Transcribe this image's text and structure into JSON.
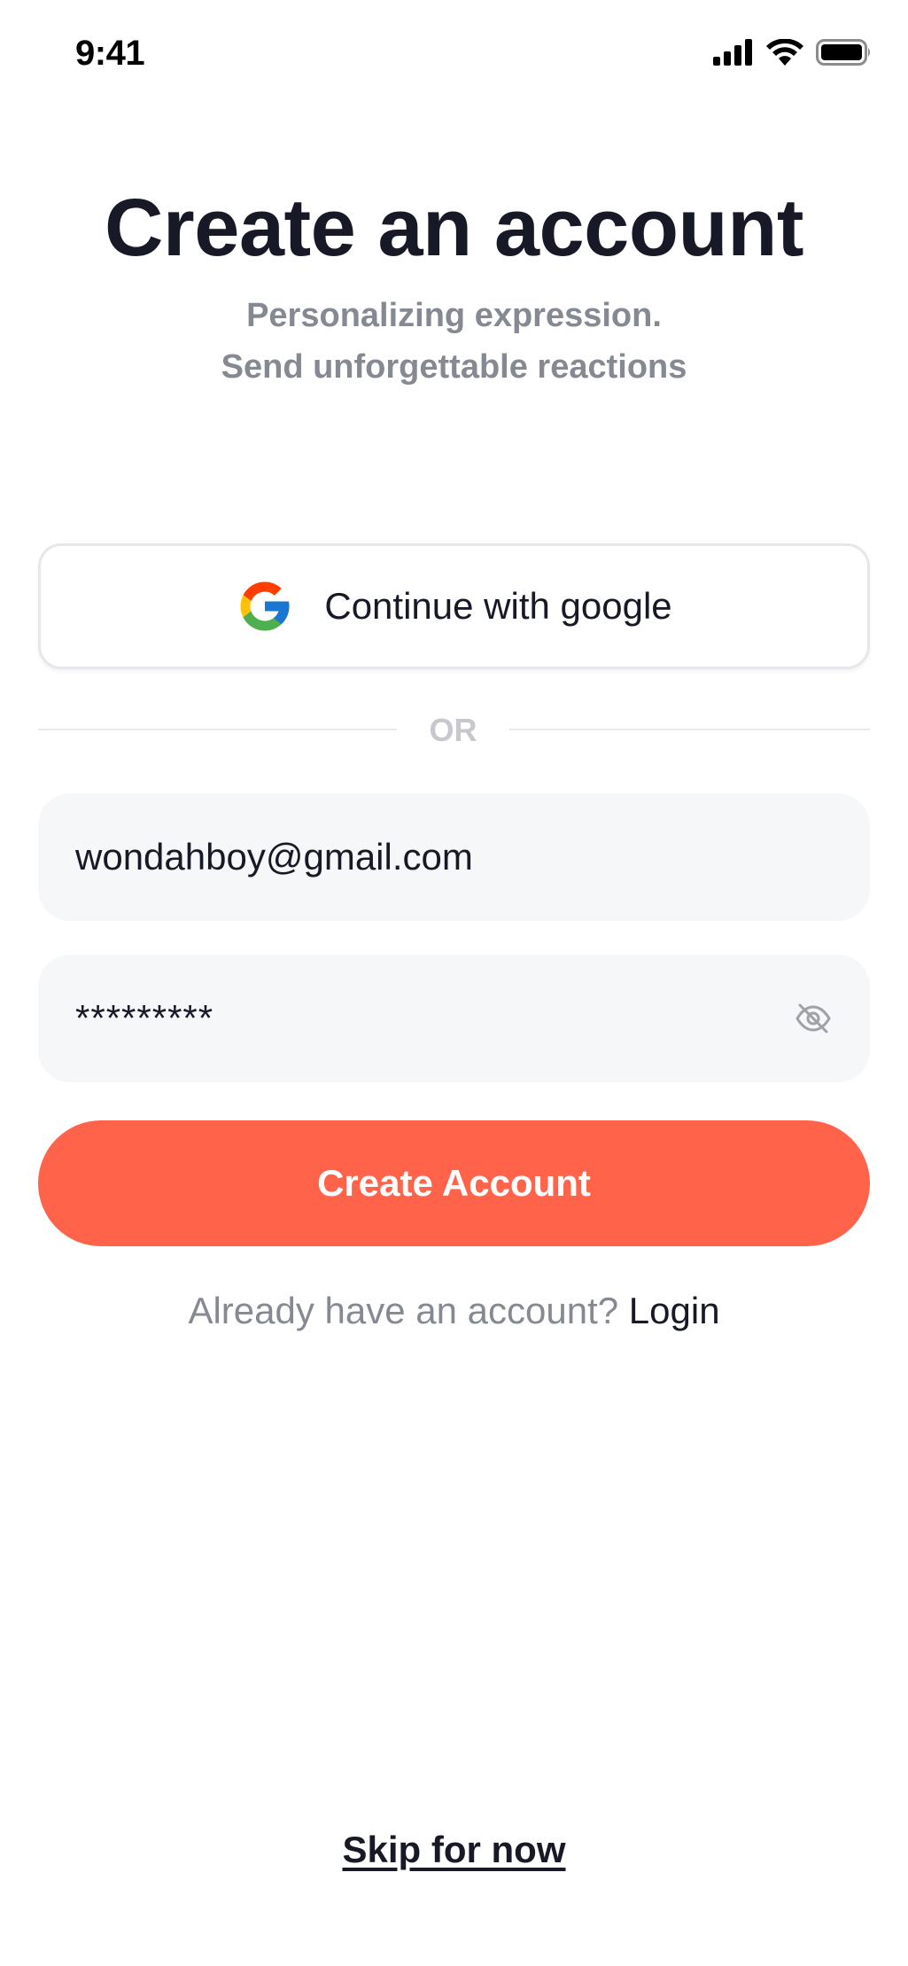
{
  "status_bar": {
    "time": "9:41",
    "icons": [
      "signal-icon",
      "wifi-icon",
      "battery-icon"
    ]
  },
  "header": {
    "title": "Create an account",
    "subtitle_line1": "Personalizing expression.",
    "subtitle_line2": "Send unforgettable reactions"
  },
  "google_button": {
    "label": "Continue with google",
    "icon": "google-logo-icon"
  },
  "divider": {
    "label": "OR"
  },
  "email_field": {
    "value": "wondahboy@gmail.com"
  },
  "password_field": {
    "value": "*********",
    "toggle_icon": "eye-off-icon"
  },
  "primary_button": {
    "label": "Create Account",
    "color": "#ff634a"
  },
  "login": {
    "prompt": "Already have an account?",
    "link": "Login"
  },
  "skip": {
    "label": "Skip for now"
  },
  "colors": {
    "text_primary": "#171a26",
    "text_secondary": "#858992",
    "input_bg": "#f6f7f9",
    "accent": "#ff634a"
  }
}
